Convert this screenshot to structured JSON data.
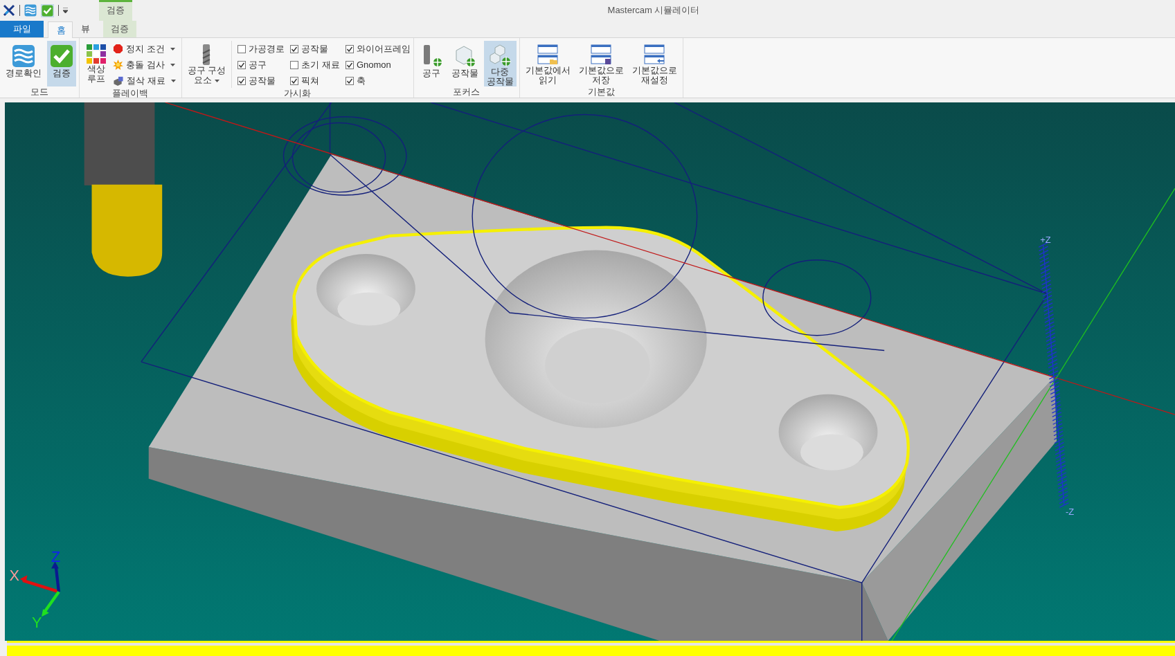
{
  "title_bar": {
    "title": "Mastercam 시뮬레이터",
    "context_group": "검증"
  },
  "tabs": [
    {
      "label": "파일",
      "kind": "file",
      "selected": false
    },
    {
      "label": "홈",
      "kind": "normal",
      "selected": true
    },
    {
      "label": "뷰",
      "kind": "normal",
      "selected": false
    },
    {
      "label": "검증",
      "kind": "context",
      "selected": false
    }
  ],
  "ribbon": {
    "groups": [
      {
        "label": "모드",
        "items": [
          {
            "kind": "large",
            "lines": [
              "경로확인"
            ],
            "selected": false
          },
          {
            "kind": "large",
            "lines": [
              "검증"
            ],
            "selected": true
          }
        ]
      },
      {
        "label": "플레이백",
        "items": [
          {
            "kind": "large",
            "lines": [
              "색상",
              "루프"
            ],
            "selected": false
          },
          {
            "kind": "smallstack",
            "items": [
              {
                "label": "정지 조건",
                "dropdown": true
              },
              {
                "label": "충돌 검사",
                "dropdown": true
              },
              {
                "label": "절삭 재료",
                "dropdown": true
              }
            ]
          }
        ]
      },
      {
        "label": "가시화",
        "items": [
          {
            "kind": "large",
            "lines": [
              "공구 구성",
              "요소"
            ],
            "dropdown": true,
            "selected": false
          },
          {
            "kind": "checkcol",
            "items": [
              {
                "label": "가공경로",
                "checked": false
              },
              {
                "label": "공구",
                "checked": true
              },
              {
                "label": "공작물",
                "checked": true
              }
            ]
          },
          {
            "kind": "checkcol",
            "items": [
              {
                "label": "공작물",
                "checked": true
              },
              {
                "label": "초기 재료",
                "checked": false
              },
              {
                "label": "픽쳐",
                "checked": true
              }
            ]
          },
          {
            "kind": "checkcol",
            "items": [
              {
                "label": "와이어프레임",
                "checked": true
              },
              {
                "label": "Gnomon",
                "checked": true
              },
              {
                "label": "축",
                "checked": true
              }
            ]
          }
        ]
      },
      {
        "label": "포커스",
        "items": [
          {
            "kind": "large",
            "lines": [
              "공구"
            ],
            "selected": false
          },
          {
            "kind": "large",
            "lines": [
              "공작물"
            ],
            "selected": false
          },
          {
            "kind": "large",
            "lines": [
              "다중",
              "공작물"
            ],
            "selected": true
          }
        ]
      },
      {
        "label": "기본값",
        "items": [
          {
            "kind": "large",
            "lines": [
              "기본값에서",
              "읽기"
            ],
            "selected": false
          },
          {
            "kind": "large",
            "lines": [
              "기본값으로",
              "저장"
            ],
            "selected": false
          },
          {
            "kind": "large",
            "lines": [
              "기본값으로",
              "재설정"
            ],
            "selected": false
          }
        ]
      }
    ]
  },
  "viewport": {
    "gnomon": {
      "x": "X",
      "y": "Y",
      "z": "Z"
    },
    "axis_labels": [
      "+Z",
      "-Z"
    ]
  }
}
